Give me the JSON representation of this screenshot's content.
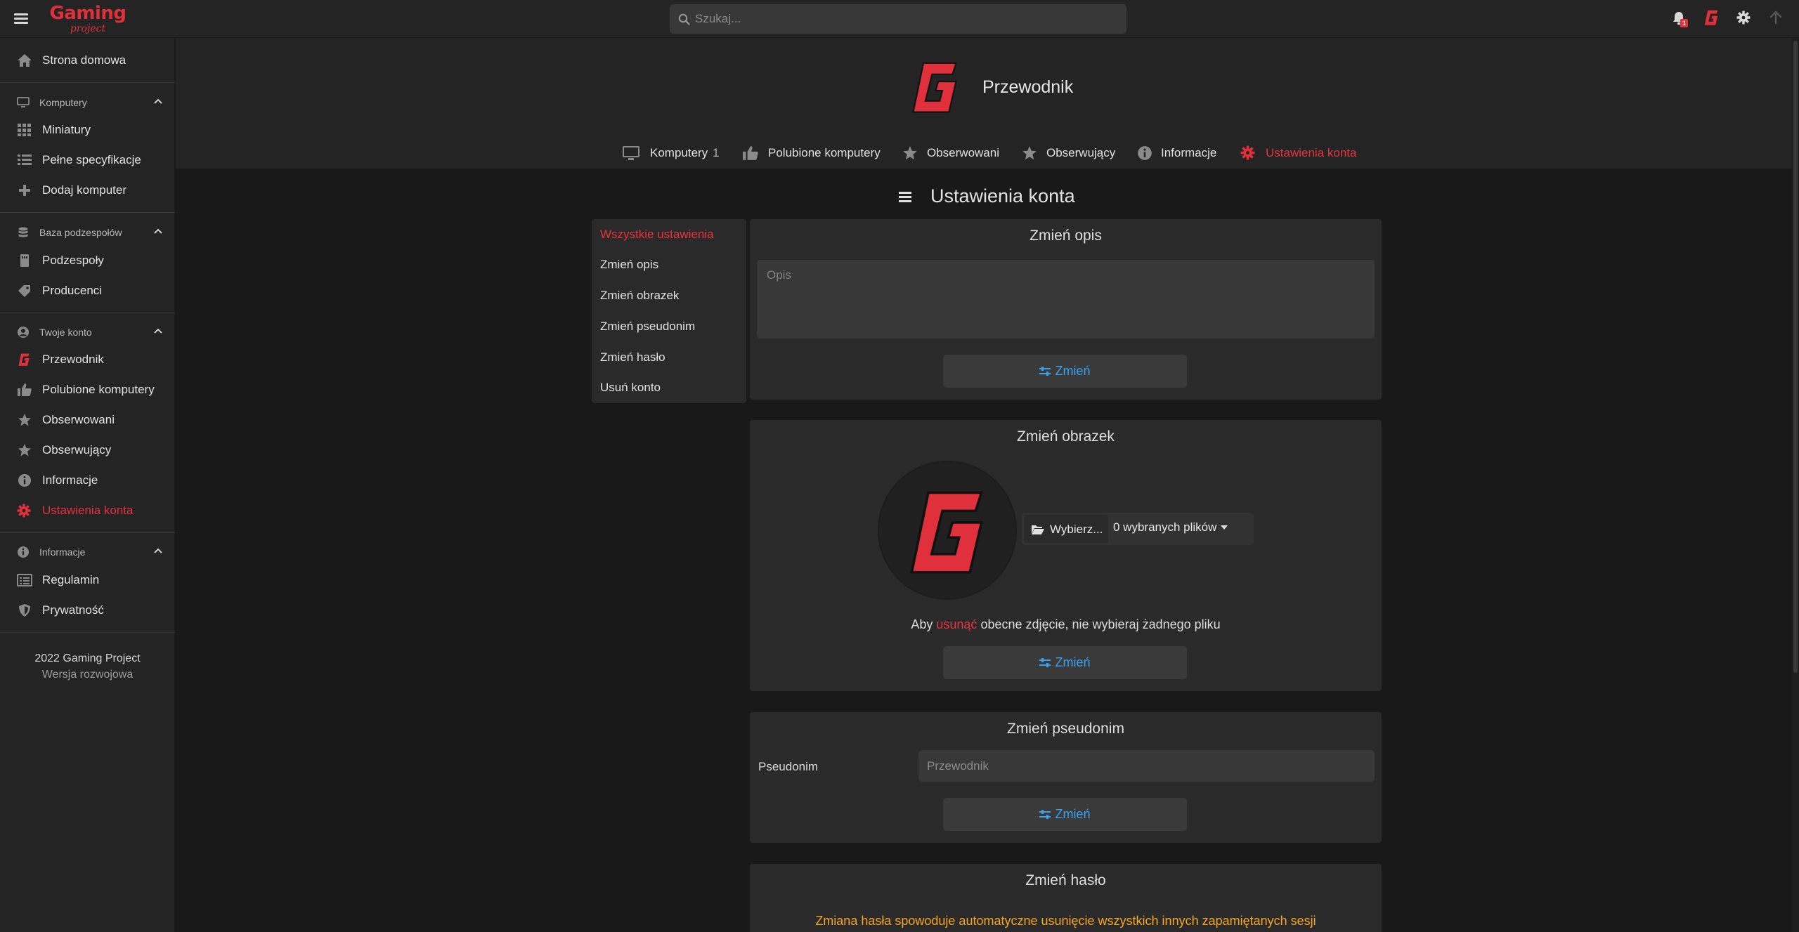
{
  "brand": {
    "name": "Gaming",
    "tagline": "project",
    "color": "#e0303b"
  },
  "search": {
    "placeholder": "Szukaj..."
  },
  "topbar": {
    "notifications_count": "1"
  },
  "sidebar": {
    "items": [
      {
        "id": "home",
        "label": "Strona domowa",
        "icon": "home-icon"
      }
    ],
    "sections": [
      {
        "id": "computers",
        "label": "Komputery",
        "icon": "monitor-icon",
        "items": [
          {
            "label": "Miniatury",
            "icon": "grid-icon"
          },
          {
            "label": "Pełne specyfikacje",
            "icon": "list-icon"
          },
          {
            "label": "Dodaj komputer",
            "icon": "plus-icon"
          }
        ]
      },
      {
        "id": "parts",
        "label": "Baza podzespołów",
        "icon": "database-icon",
        "items": [
          {
            "label": "Podzespoły",
            "icon": "memory-icon"
          },
          {
            "label": "Producenci",
            "icon": "tag-icon"
          }
        ]
      },
      {
        "id": "account",
        "label": "Twoje konto",
        "icon": "user-circle-icon",
        "items": [
          {
            "label": "Przewodnik",
            "icon": "profile-logo-icon"
          },
          {
            "label": "Polubione komputery",
            "icon": "thumbs-up-icon"
          },
          {
            "label": "Obserwowani",
            "icon": "star-icon"
          },
          {
            "label": "Obserwujący",
            "icon": "star-icon"
          },
          {
            "label": "Informacje",
            "icon": "info-icon"
          },
          {
            "label": "Ustawienia konta",
            "icon": "gear-icon",
            "active": true
          }
        ]
      },
      {
        "id": "info",
        "label": "Informacje",
        "icon": "info-icon",
        "items": [
          {
            "label": "Regulamin",
            "icon": "document-icon"
          },
          {
            "label": "Prywatność",
            "icon": "shield-icon"
          }
        ]
      }
    ],
    "footer": {
      "copyright": "2022 Gaming Project",
      "version": "Wersja rozwojowa"
    }
  },
  "profile": {
    "name": "Przewodnik",
    "tabs": [
      {
        "label": "Komputery",
        "count": "1",
        "icon": "monitor-icon"
      },
      {
        "label": "Polubione komputery",
        "icon": "thumbs-up-icon"
      },
      {
        "label": "Obserwowani",
        "icon": "star-icon"
      },
      {
        "label": "Obserwujący",
        "icon": "star-icon"
      },
      {
        "label": "Informacje",
        "icon": "info-icon"
      },
      {
        "label": "Ustawienia konta",
        "icon": "gear-icon",
        "active": true
      }
    ]
  },
  "settings": {
    "title": "Ustawienia konta",
    "nav": [
      {
        "label": "Wszystkie ustawienia",
        "active": true
      },
      {
        "label": "Zmień opis"
      },
      {
        "label": "Zmień obrazek"
      },
      {
        "label": "Zmień pseudonim"
      },
      {
        "label": "Zmień hasło"
      },
      {
        "label": "Usuń konto"
      }
    ],
    "change_button_label": "Zmień",
    "description": {
      "title": "Zmień opis",
      "placeholder": "Opis",
      "value": ""
    },
    "picture": {
      "title": "Zmień obrazek",
      "choose_label": "Wybierz...",
      "files_selected": "0 wybranych plików",
      "note_prefix": "Aby",
      "note_link": "usunąć",
      "note_suffix": "obecne zdjęcie, nie wybieraj żadnego pliku"
    },
    "nickname": {
      "title": "Zmień pseudonim",
      "label": "Pseudonim",
      "placeholder": "Przewodnik"
    },
    "password": {
      "title": "Zmień hasło",
      "warning": "Zmiana hasła spowoduje automatyczne usunięcie wszystkich innych zapamiętanych sesji"
    }
  },
  "colors": {
    "accent": "#e8323e",
    "link": "#3aa0f0",
    "warning": "#f5a623",
    "background": "#191919",
    "panel": "#242424",
    "card": "#2a2a2a"
  }
}
